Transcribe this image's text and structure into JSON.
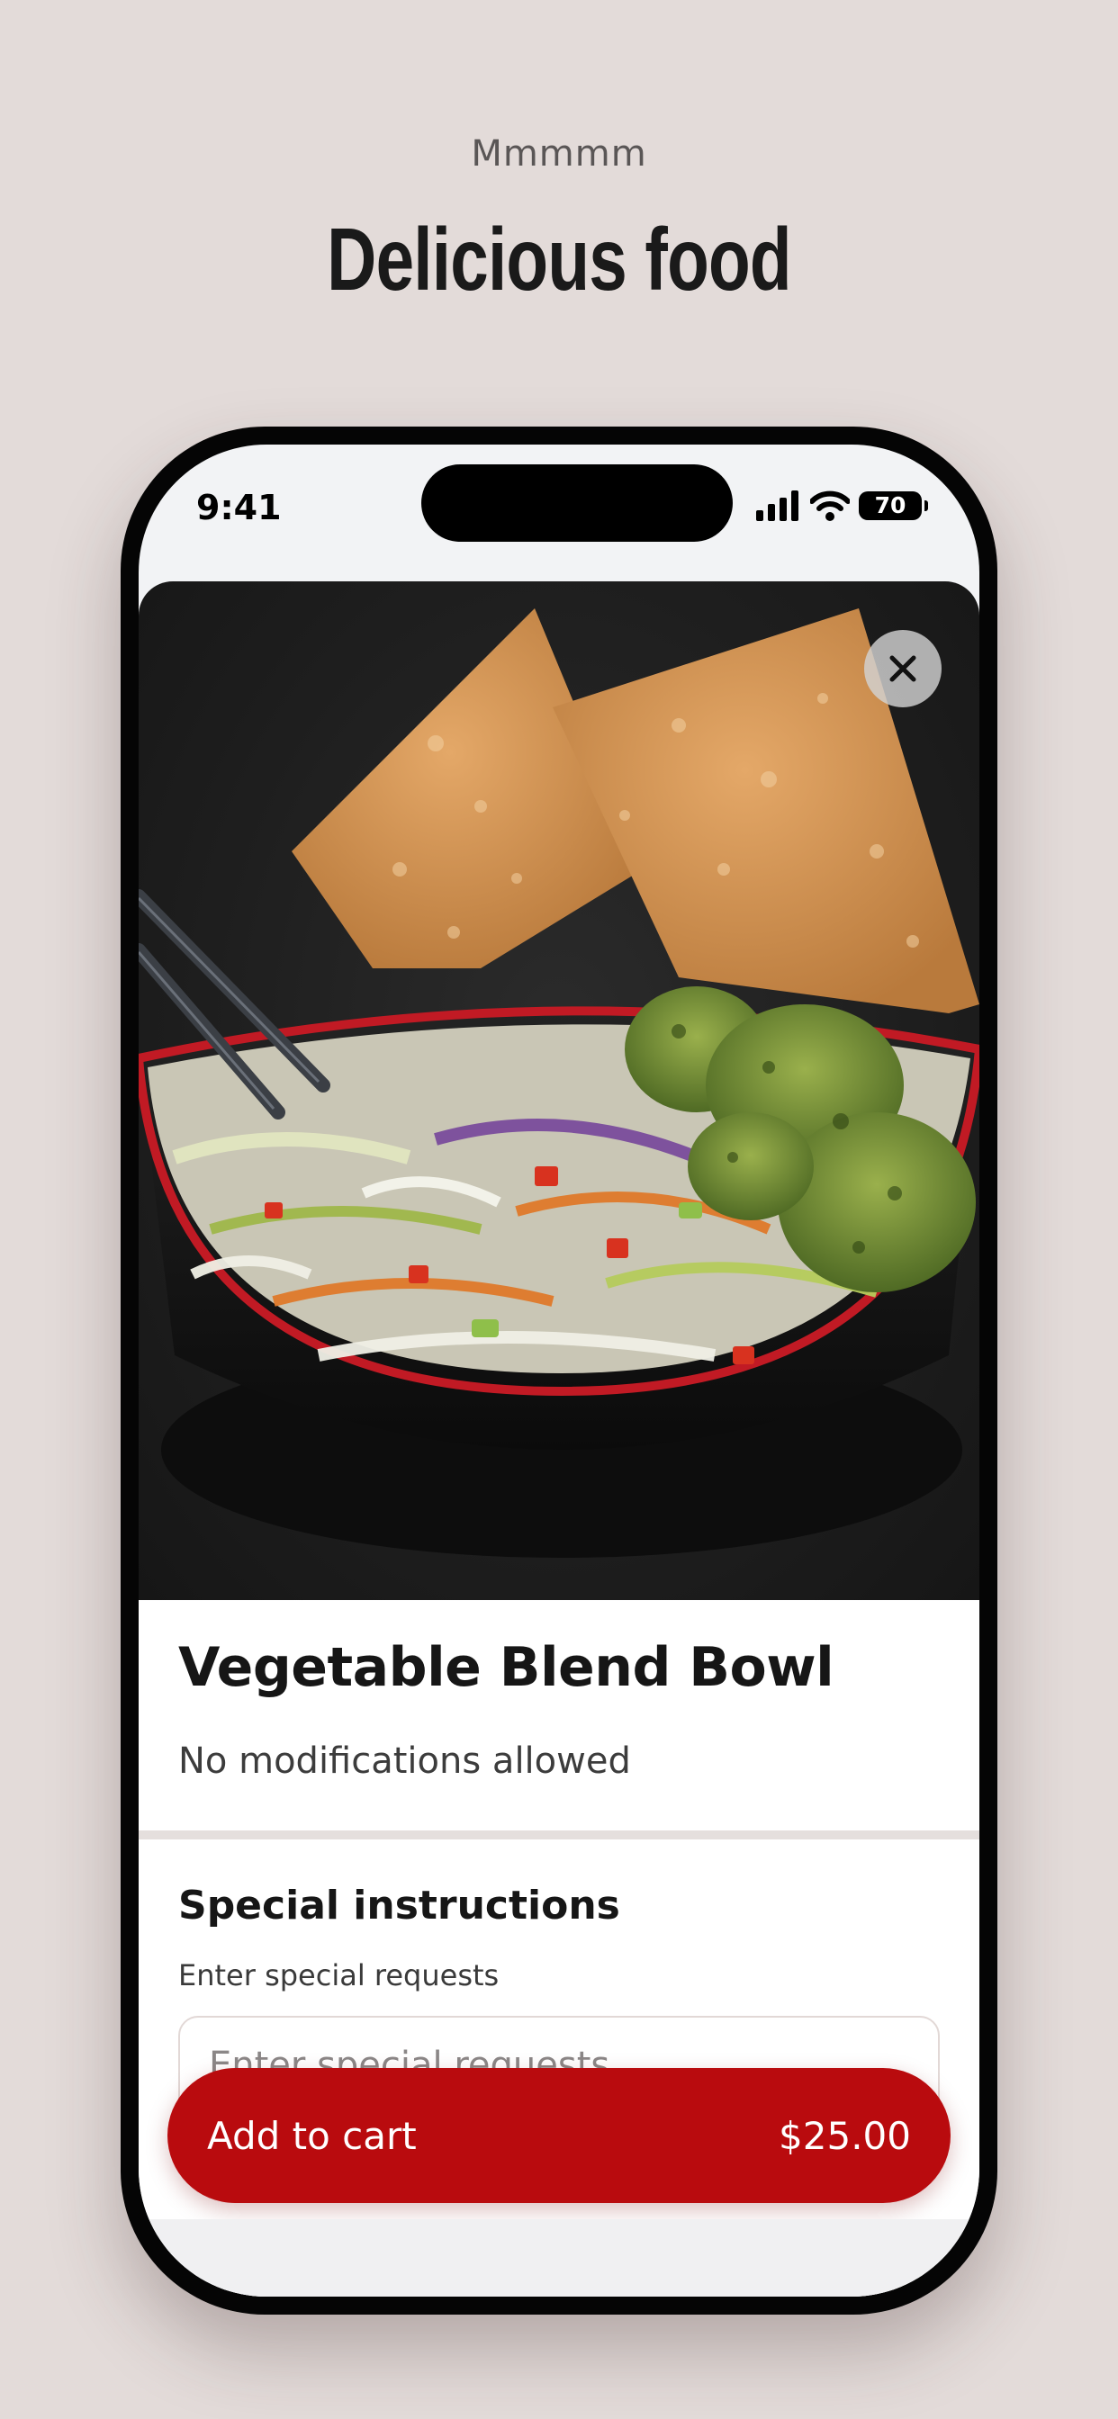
{
  "page": {
    "eyebrow": "Mmmmm",
    "headline": "Delicious food"
  },
  "status_bar": {
    "time": "9:41",
    "battery": "70"
  },
  "item": {
    "close_icon": "close-icon",
    "name": "Vegetable Blend Bowl",
    "note": "No modifications allowed"
  },
  "special_instructions": {
    "title": "Special instructions",
    "hint": "Enter special requests",
    "placeholder": "Enter special requests"
  },
  "cart_button": {
    "label": "Add to cart",
    "price": "$25.00"
  },
  "colors": {
    "background": "#e3dbd9",
    "accent": "#b90b0e",
    "divider": "#e5dfdd"
  }
}
